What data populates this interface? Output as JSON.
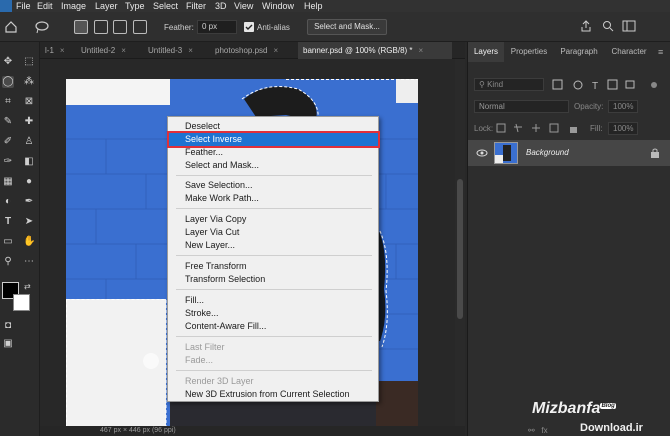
{
  "menubar": {
    "items": [
      "File",
      "Edit",
      "Image",
      "Layer",
      "Type",
      "Select",
      "Filter",
      "3D",
      "View",
      "Window",
      "Help"
    ]
  },
  "options": {
    "feather_label": "Feather:",
    "feather_value": "0 px",
    "antialias_label": "Anti-alias",
    "select_mask_label": "Select and Mask..."
  },
  "tabs": [
    {
      "label": "l-1",
      "close": "×"
    },
    {
      "label": "Untitled-2",
      "close": "×"
    },
    {
      "label": "Untitled-3",
      "close": "×"
    },
    {
      "label": "photoshop.psd",
      "close": "×"
    },
    {
      "label": "banner.psd @ 100% (RGB/8) *",
      "close": "×"
    }
  ],
  "context_menu": {
    "groups": [
      [
        "Deselect",
        "Select Inverse",
        "Feather...",
        "Select and Mask..."
      ],
      [
        "Save Selection...",
        "Make Work Path..."
      ],
      [
        "Layer Via Copy",
        "Layer Via Cut",
        "New Layer..."
      ],
      [
        "Free Transform",
        "Transform Selection"
      ],
      [
        "Fill...",
        "Stroke...",
        "Content-Aware Fill..."
      ],
      [
        "Last Filter",
        "Fade..."
      ],
      [
        "Render 3D Layer",
        "New 3D Extrusion from Current Selection"
      ]
    ],
    "highlighted": "Select Inverse",
    "disabled": [
      "Last Filter",
      "Fade...",
      "Render 3D Layer"
    ]
  },
  "panel": {
    "tabs": [
      "Layers",
      "Properties",
      "Paragraph",
      "Character"
    ],
    "kind_placeholder": "Kind",
    "blend_mode": "Normal",
    "opacity_label": "Opacity:",
    "opacity_value": "100%",
    "lock_label": "Lock:",
    "fill_label": "Fill:",
    "fill_value": "100%",
    "layer_name": "Background"
  },
  "status": {
    "text": "467 px × 446 px (96 ppi)"
  },
  "watermark": {
    "brand": "Mizbanfa",
    "brand_sup": "Blog",
    "download": "Download.ir"
  },
  "colors": {
    "highlight": "#1e73d2",
    "highlight_outline": "#e0303a",
    "arrow": "#e9b71f",
    "canvas_blue": "#3a6fd0"
  }
}
